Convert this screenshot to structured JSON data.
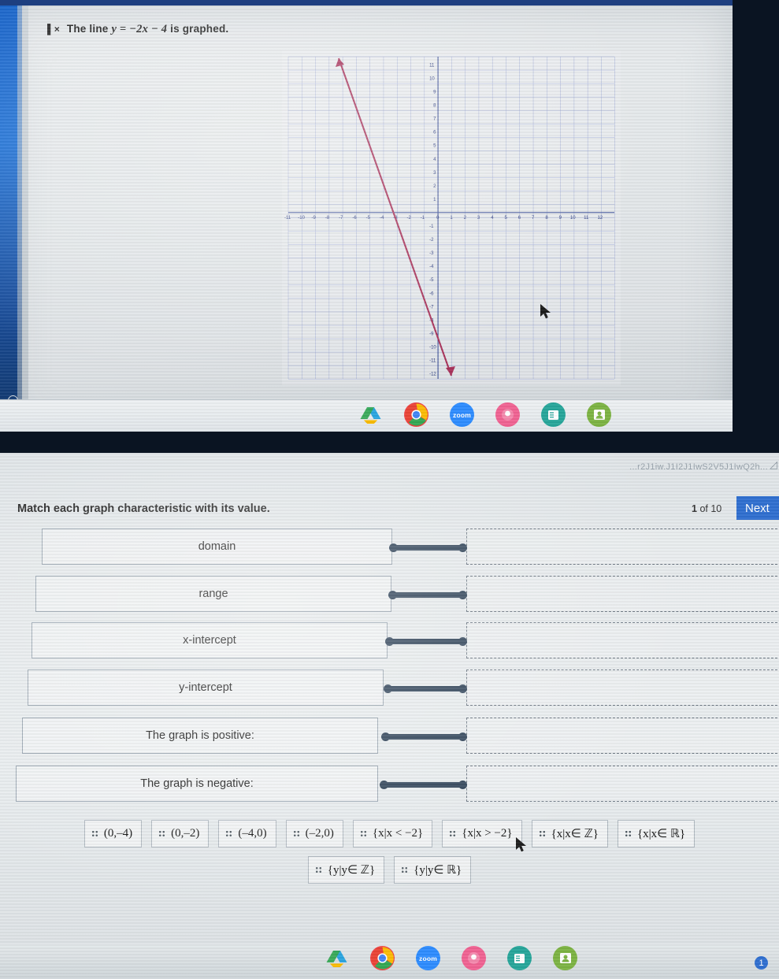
{
  "top": {
    "question_prefix": "The line",
    "question_equation": "y = −2x − 4",
    "question_suffix": "is graphed.",
    "speaker_icon": "speaker-mute-icon",
    "graph": {
      "x_ticks": [
        "-11",
        "-10",
        "-9",
        "-8",
        "-7",
        "-6",
        "-5",
        "-4",
        "-3",
        "-2",
        "-1",
        "0",
        "1",
        "2",
        "3",
        "4",
        "5",
        "6",
        "7",
        "8",
        "9",
        "10",
        "11",
        "12"
      ],
      "y_ticks": [
        "11",
        "10",
        "9",
        "8",
        "7",
        "6",
        "5",
        "4",
        "3",
        "2",
        "1",
        "-1",
        "-2",
        "-3",
        "-4",
        "-5",
        "-6",
        "-7",
        "-8",
        "-9",
        "-10",
        "-11",
        "-12"
      ],
      "line_color": "#a8325a",
      "grid_color": "#5b6fb0",
      "axis_color": "#3b4f96"
    },
    "taskbar": {
      "items": [
        {
          "name": "drive-icon",
          "label": ""
        },
        {
          "name": "chrome-icon",
          "label": ""
        },
        {
          "name": "zoom-icon",
          "label": "zoom"
        },
        {
          "name": "pink-app-icon",
          "label": ""
        },
        {
          "name": "teal-app-icon",
          "label": ""
        },
        {
          "name": "contacts-icon",
          "label": ""
        }
      ]
    }
  },
  "bottom": {
    "url_ghost": "...r2J1iw.J1I2J1IwS2V5J1IwQ2h...",
    "prompt": "Match each graph characteristic with its value.",
    "counter_current": "1",
    "counter_text": "of 10",
    "next_label": "Next",
    "rows": [
      {
        "label": "domain"
      },
      {
        "label": "range"
      },
      {
        "label": "x-intercept"
      },
      {
        "label": "y-intercept"
      },
      {
        "label": "The graph is positive:"
      },
      {
        "label": "The graph is negative:"
      }
    ],
    "chips_row1": [
      "(0,–4)",
      "(0,–2)",
      "(–4,0)",
      "(–2,0)",
      "{x|x < −2}",
      "{x|x > −2}",
      "{x|x∈ ℤ}",
      "{x|x∈ ℝ}"
    ],
    "chips_row2": [
      "{y|y∈ ℤ}",
      "{y|y∈ ℝ}"
    ],
    "taskbar": {
      "items": [
        {
          "name": "drive-icon",
          "label": ""
        },
        {
          "name": "chrome-icon",
          "label": ""
        },
        {
          "name": "zoom-icon",
          "label": "zoom"
        },
        {
          "name": "pink-app-icon",
          "label": ""
        },
        {
          "name": "teal-app-icon",
          "label": ""
        },
        {
          "name": "contacts-icon",
          "label": ""
        }
      ]
    },
    "badge": "1"
  },
  "colors": {
    "accent": "#2f6fd0",
    "connector": "#2b3f55",
    "line": "#a8325a"
  }
}
